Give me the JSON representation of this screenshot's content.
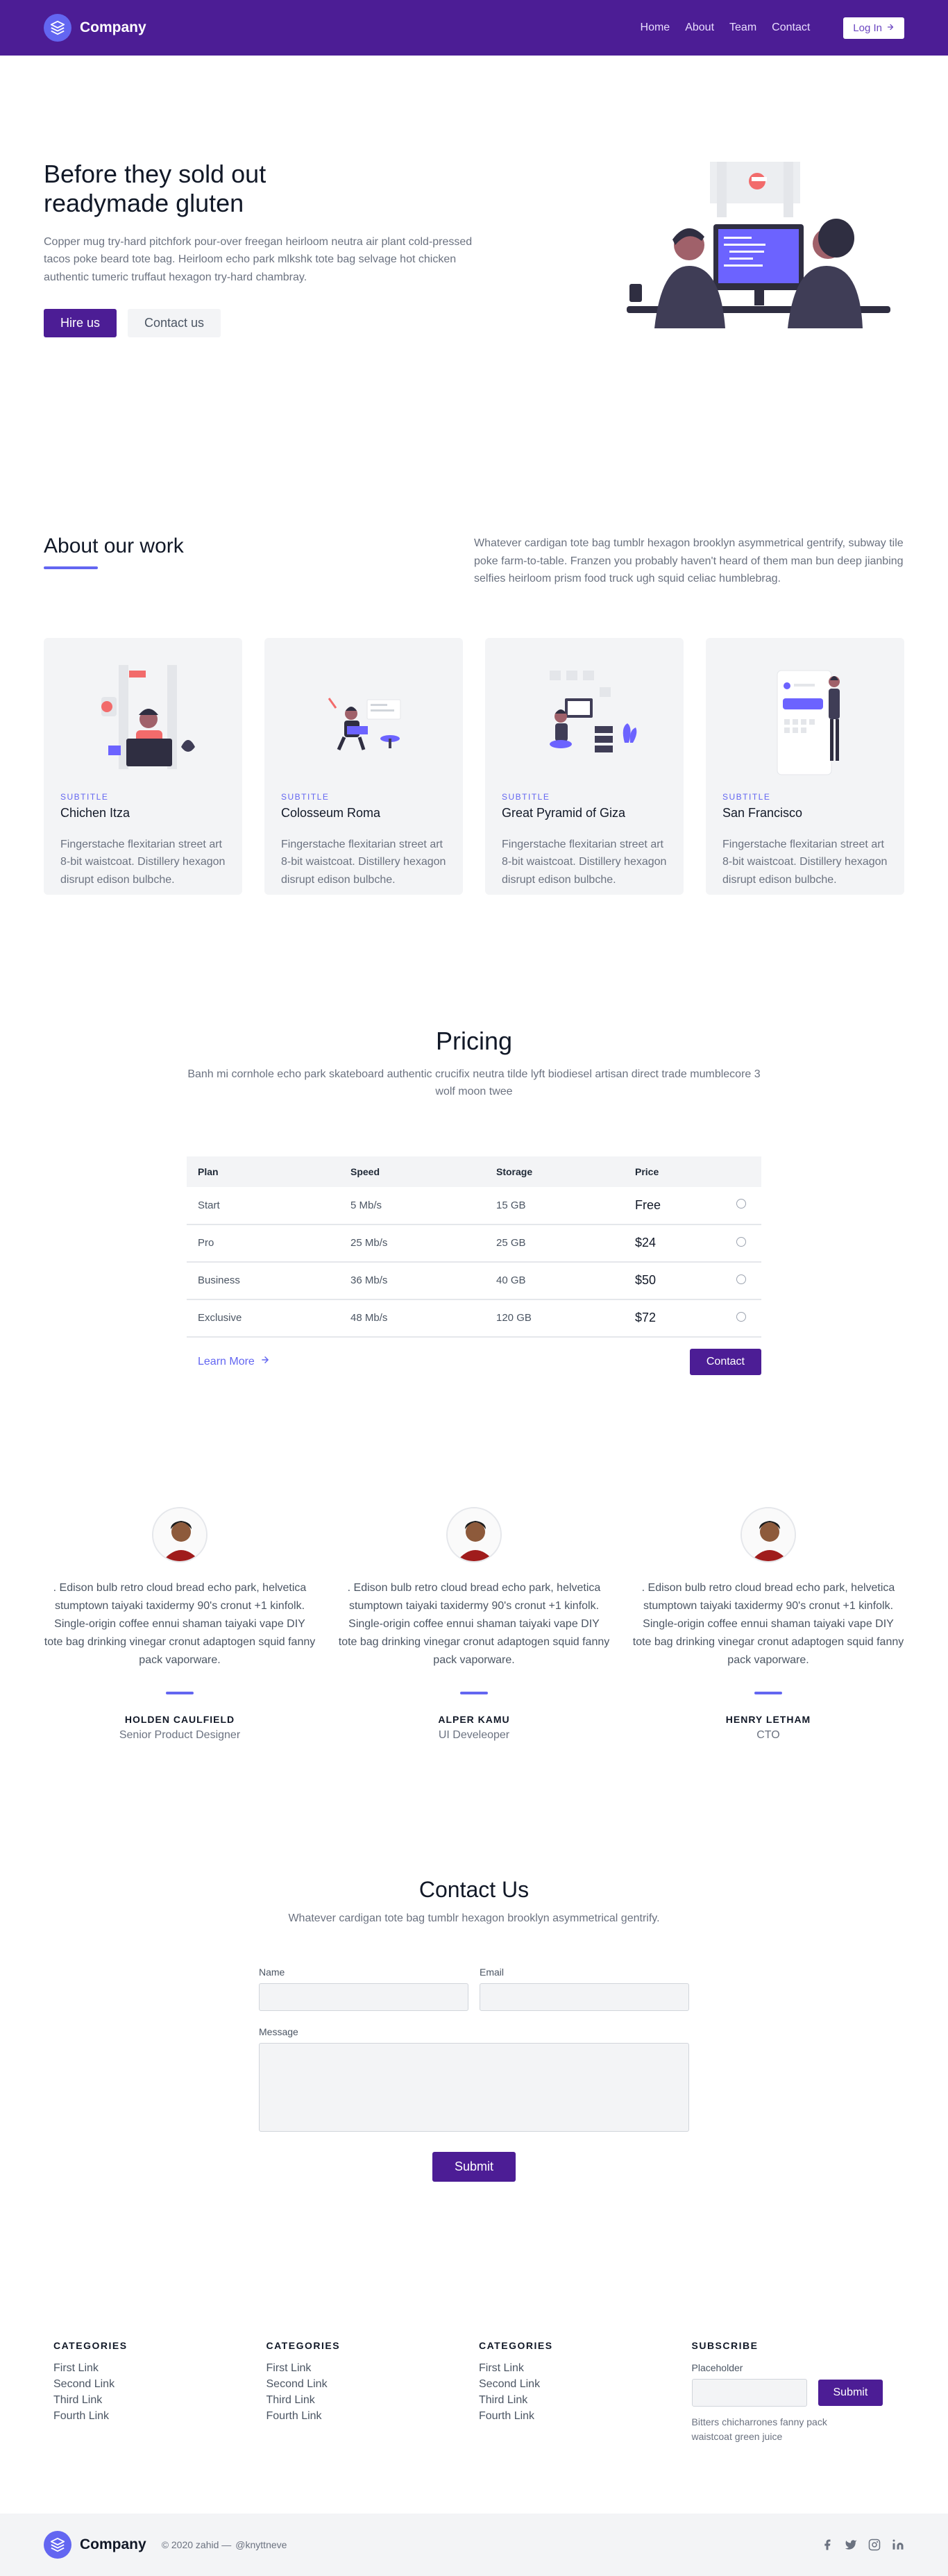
{
  "header": {
    "brand": "Company",
    "nav": [
      "Home",
      "About",
      "Team",
      "Contact"
    ],
    "login_label": "Log In"
  },
  "hero": {
    "title_line1": "Before they sold out",
    "title_line2": "readymade gluten",
    "description": "Copper mug try-hard pitchfork pour-over freegan heirloom neutra air plant cold-pressed tacos poke beard tote bag. Heirloom echo park mlkshk tote bag selvage hot chicken authentic tumeric truffaut hexagon try-hard chambray.",
    "primary_button": "Hire us",
    "secondary_button": "Contact us"
  },
  "about": {
    "title": "About our work",
    "description": "Whatever cardigan tote bag tumblr hexagon brooklyn asymmetrical gentrify, subway tile poke farm-to-table. Franzen you probably haven't heard of them man bun deep jianbing selfies heirloom prism food truck ugh squid celiac humblebrag.",
    "cards": [
      {
        "subtitle": "SUBTITLE",
        "title": "Chichen Itza",
        "description": "Fingerstache flexitarian street art 8-bit waistcoat. Distillery hexagon disrupt edison bulbche."
      },
      {
        "subtitle": "SUBTITLE",
        "title": "Colosseum Roma",
        "description": "Fingerstache flexitarian street art 8-bit waistcoat. Distillery hexagon disrupt edison bulbche."
      },
      {
        "subtitle": "SUBTITLE",
        "title": "Great Pyramid of Giza",
        "description": "Fingerstache flexitarian street art 8-bit waistcoat. Distillery hexagon disrupt edison bulbche."
      },
      {
        "subtitle": "SUBTITLE",
        "title": "San Francisco",
        "description": "Fingerstache flexitarian street art 8-bit waistcoat. Distillery hexagon disrupt edison bulbche."
      }
    ]
  },
  "pricing": {
    "title": "Pricing",
    "description": "Banh mi cornhole echo park skateboard authentic crucifix neutra tilde lyft biodiesel artisan direct trade mumblecore 3 wolf moon twee",
    "columns": [
      "Plan",
      "Speed",
      "Storage",
      "Price"
    ],
    "rows": [
      {
        "plan": "Start",
        "speed": "5 Mb/s",
        "storage": "15 GB",
        "price": "Free"
      },
      {
        "plan": "Pro",
        "speed": "25 Mb/s",
        "storage": "25 GB",
        "price": "$24"
      },
      {
        "plan": "Business",
        "speed": "36 Mb/s",
        "storage": "40 GB",
        "price": "$50"
      },
      {
        "plan": "Exclusive",
        "speed": "48 Mb/s",
        "storage": "120 GB",
        "price": "$72"
      }
    ],
    "learn_more": "Learn More",
    "contact_button": "Contact"
  },
  "testimonials": [
    {
      "quote": ". Edison bulb retro cloud bread echo park, helvetica stumptown taiyaki taxidermy 90's cronut +1 kinfolk. Single-origin coffee ennui shaman taiyaki vape DIY tote bag drinking vinegar cronut adaptogen squid fanny pack vaporware.",
      "name": "HOLDEN CAULFIELD",
      "role": "Senior Product Designer"
    },
    {
      "quote": ". Edison bulb retro cloud bread echo park, helvetica stumptown taiyaki taxidermy 90's cronut +1 kinfolk. Single-origin coffee ennui shaman taiyaki vape DIY tote bag drinking vinegar cronut adaptogen squid fanny pack vaporware.",
      "name": "ALPER KAMU",
      "role": "UI Develeoper"
    },
    {
      "quote": ". Edison bulb retro cloud bread echo park, helvetica stumptown taiyaki taxidermy 90's cronut +1 kinfolk. Single-origin coffee ennui shaman taiyaki vape DIY tote bag drinking vinegar cronut adaptogen squid fanny pack vaporware.",
      "name": "HENRY LETHAM",
      "role": "CTO"
    }
  ],
  "contact": {
    "title": "Contact Us",
    "description": "Whatever cardigan tote bag tumblr hexagon brooklyn asymmetrical gentrify.",
    "name_label": "Name",
    "email_label": "Email",
    "message_label": "Message",
    "submit_label": "Submit"
  },
  "footer": {
    "columns": [
      {
        "title": "CATEGORIES",
        "links": [
          "First Link",
          "Second Link",
          "Third Link",
          "Fourth Link"
        ]
      },
      {
        "title": "CATEGORIES",
        "links": [
          "First Link",
          "Second Link",
          "Third Link",
          "Fourth Link"
        ]
      },
      {
        "title": "CATEGORIES",
        "links": [
          "First Link",
          "Second Link",
          "Third Link",
          "Fourth Link"
        ]
      }
    ],
    "subscribe": {
      "title": "SUBSCRIBE",
      "label": "Placeholder",
      "button": "Submit",
      "note": "Bitters chicharrones fanny pack waistcoat green juice"
    },
    "bottom": {
      "brand": "Company",
      "copyright": "© 2020 zahid —",
      "handle": "@knyttneve"
    },
    "social_icons": [
      "facebook-icon",
      "twitter-icon",
      "instagram-icon",
      "linkedin-icon"
    ]
  },
  "colors": {
    "brand_purple": "#4c1d95",
    "accent_indigo": "#6366f1",
    "light_gray": "#f3f4f6"
  }
}
